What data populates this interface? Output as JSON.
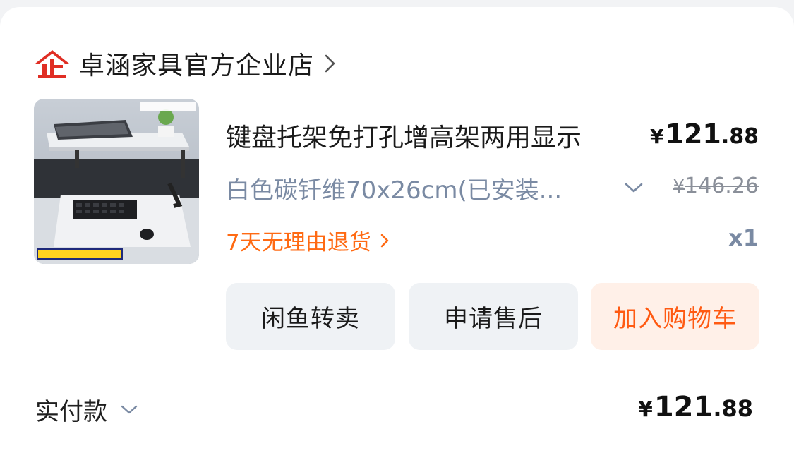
{
  "shop": {
    "badge_icon": "enterprise-badge-icon",
    "badge_text": "企",
    "name": "卓涵家具官方企业店",
    "accent": "#e02e24"
  },
  "product": {
    "title": "键盘托架免打孔增高架两用显示",
    "price": {
      "currency": "¥",
      "integer": "121",
      "decimal": ".88"
    },
    "spec": "白色碳钎维70x26cm(已安装...",
    "original_price": {
      "currency": "¥",
      "amount": "146.26"
    },
    "return_policy": "7天无理由退货",
    "quantity": "x1",
    "image_icon": "product-image-keyboard-tray"
  },
  "actions": [
    {
      "label": "闲鱼转卖"
    },
    {
      "label": "申请售后"
    },
    {
      "label": "加入购物车"
    }
  ],
  "payment": {
    "label": "实付款",
    "total": {
      "currency": "¥",
      "integer": "121",
      "decimal": ".88"
    }
  },
  "colors": {
    "accent_orange": "#ff5a12",
    "spec_gray": "#7a8aa3",
    "button_gray": "#eff2f5",
    "button_orange_bg": "#fff0e8"
  }
}
